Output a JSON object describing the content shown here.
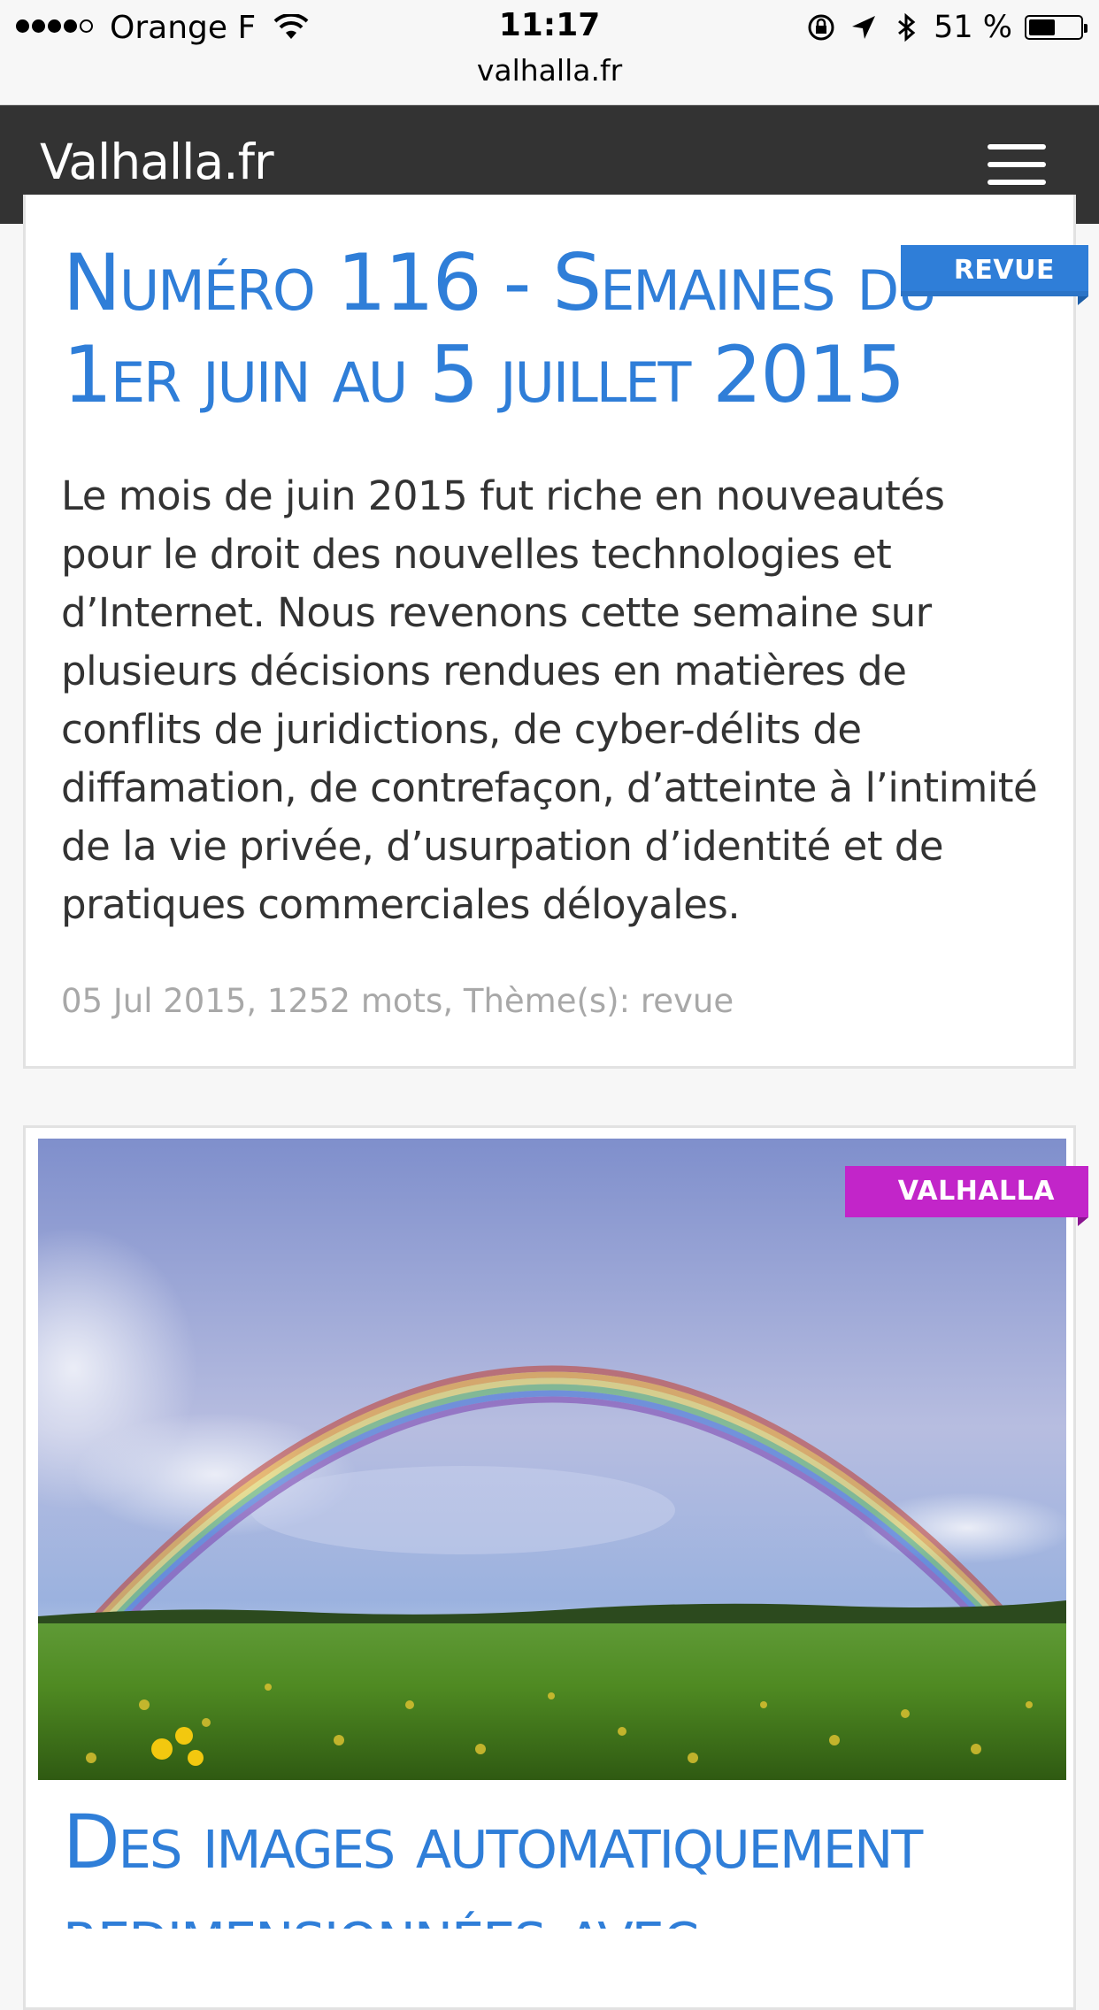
{
  "status_bar": {
    "carrier": "Orange F",
    "time": "11:17",
    "url": "valhalla.fr",
    "battery_percent": "51 %",
    "battery_level": 0.51,
    "icons": [
      "signal-dots",
      "wifi-icon",
      "rotation-lock-icon",
      "location-arrow-icon",
      "bluetooth-icon",
      "battery-icon"
    ]
  },
  "navbar": {
    "brand": "Valhalla.fr",
    "menu_icon": "hamburger-icon",
    "background": "#333333"
  },
  "posts": [
    {
      "category": "REVUE",
      "category_color": "#2f7ed8",
      "title": "Numéro 116 - Semaines du 1er juin au 5 juillet 2015",
      "excerpt": "Le mois de juin 2015 fut riche en nouveautés pour le droit des nouvelles technologies et d’Internet. Nous revenons cette semaine sur plusieurs décisions rendues en matières de conflits de juridictions, de cyber-délits de diffamation, de contrefaçon, d’atteinte à l’intimité de la vie privée, d’usurpation d’identité et de pratiques commerciales déloyales.",
      "meta": "05 Jul 2015, 1252 mots, Thème(s): revue"
    },
    {
      "category": "VALHALLA",
      "category_color": "#c225c9",
      "image": "rainbow-over-field",
      "title": "Des images automatiquement redimensionnées avec"
    }
  ],
  "colors": {
    "link": "#2f7ed8",
    "meta": "#a8a8a8"
  }
}
